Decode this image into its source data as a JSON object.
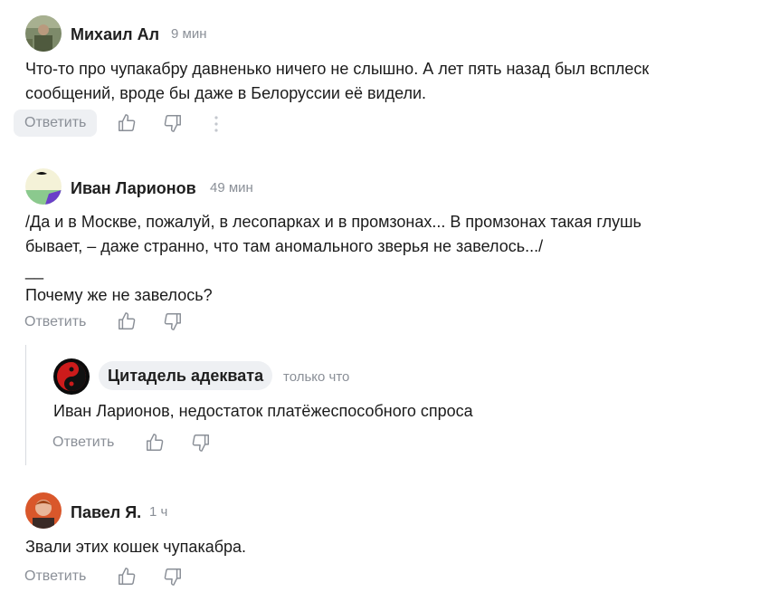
{
  "actions": {
    "reply_label": "Ответить",
    "like_icon": "thumbs-up-icon",
    "dislike_icon": "thumbs-down-icon",
    "more_icon": "vertical-dots-icon"
  },
  "comments": [
    {
      "author": "Михаил Ал",
      "time": "9 мин",
      "text": "Что-то про чупакабру давненько ничего не слышно. А лет пять назад был всплеск\nсообщений, вроде бы даже в Белоруссии её видели."
    },
    {
      "author": "Иван Ларионов",
      "time": "49 мин",
      "text": "/Да и в Москве, пожалуй, в лесопарках и в промзонах... В промзонах такая глушь\nбывает, – даже странно, что там аномального зверья не завелось.../\n__\nПочему же не завелось?"
    },
    {
      "author": "Цитадель адеквата",
      "time": "только что",
      "text": "Иван Ларионов, недостаток платёжеспособного спроса"
    },
    {
      "author": "Павел Я.",
      "time": "1 ч",
      "text": "Звали этих кошек чупакабра."
    }
  ],
  "colors": {
    "text": "#1b1b1b",
    "muted": "#8a8f97",
    "pill_bg": "#eef0f3",
    "thread_line": "#d8dbe0"
  }
}
